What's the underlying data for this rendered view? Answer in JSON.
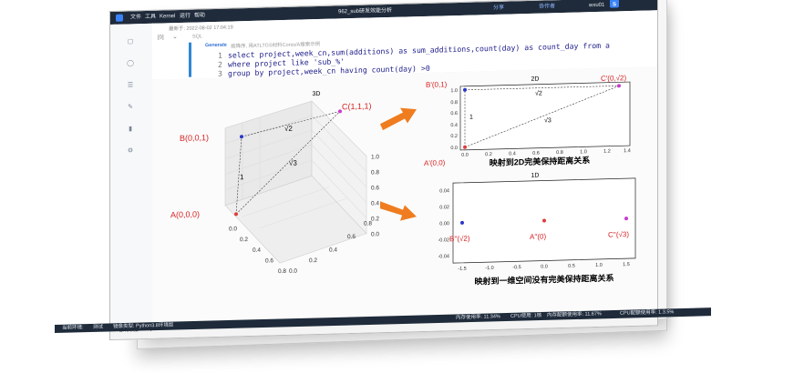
{
  "topbar": {
    "menu": [
      "文件",
      "工具",
      "Kernel",
      "运行",
      "帮助"
    ],
    "doc_title": "962_sub研发效能分析",
    "share": "分享",
    "collab": "协作者",
    "user": "wxu01",
    "avatar": "S"
  },
  "cell": {
    "saved": "最新于: 2022-08-02 17:04:19",
    "prompt_num": "[0]",
    "lang": "SQL",
    "gen_label": "Generate",
    "gen_hint": "按降序, 用ATLTGS材料Corss/A搜索示例",
    "code": [
      {
        "n": "1",
        "text": "select project,week_cn,sum(additions) as sum_additions,count(day) as count_day from a"
      },
      {
        "n": "2",
        "text": "where project like 'sub_%'"
      },
      {
        "n": "3",
        "text": "group by project,week_cn having count(day)  >0"
      }
    ]
  },
  "chart_data": [
    {
      "type": "scatter",
      "title": "3D",
      "points": [
        {
          "label": "A(0,0,0)",
          "x": 0,
          "y": 0,
          "z": 0,
          "color": "#e03a3a"
        },
        {
          "label": "B(0,0,1)",
          "x": 0,
          "y": 0,
          "z": 1,
          "color": "#2a35c8"
        },
        {
          "label": "C(1,1,1)",
          "x": 1,
          "y": 1,
          "z": 1,
          "color": "#c93ad0"
        }
      ],
      "edge_labels": [
        "1",
        "√2",
        "√3"
      ],
      "ticks": [
        "0.0",
        "0.2",
        "0.4",
        "0.6",
        "0.8",
        "1.0"
      ]
    },
    {
      "type": "scatter",
      "title": "2D",
      "caption": "映射到2D完美保持距离关系",
      "points": [
        {
          "label": "A'(0,0)",
          "x": 0,
          "y": 0,
          "color": "#e03a3a"
        },
        {
          "label": "B'(0,1)",
          "x": 0,
          "y": 1,
          "color": "#2a35c8"
        },
        {
          "label": "C'(0,√2)",
          "x": 1.3,
          "y": 1,
          "color": "#c93ad0"
        }
      ],
      "edge_labels": [
        "1",
        "√2",
        "√3"
      ],
      "xticks": [
        "0.0",
        "0.2",
        "0.4",
        "0.6",
        "0.8",
        "1.0",
        "1.2",
        "1.4"
      ],
      "yticks": [
        "0.0",
        "0.2",
        "0.4",
        "0.6",
        "0.8",
        "1.0"
      ]
    },
    {
      "type": "scatter",
      "title": "1D",
      "caption": "映射到一维空间没有完美保持距离关系",
      "points": [
        {
          "label": "B''(√2)",
          "x": -1.45,
          "y": 0,
          "color": "#2a35c8"
        },
        {
          "label": "A''(0)",
          "x": -0.1,
          "y": 0,
          "color": "#e03a3a"
        },
        {
          "label": "C''(√3)",
          "x": 1.5,
          "y": 0,
          "color": "#c93ad0"
        }
      ],
      "xticks": [
        "-1.5",
        "-1.0",
        "-0.5",
        "0.0",
        "0.5",
        "1.0",
        "1.5"
      ],
      "yticks": [
        "0.04",
        "0.02",
        "0.00",
        "-0.02",
        "-0.04"
      ]
    }
  ],
  "footer": {
    "sheet": "sheet1",
    "add": "+"
  },
  "statusbar": {
    "left": [
      "当前环境:",
      "测试",
      "镜像类型: Python3.8环境版"
    ],
    "right": [
      "内存使用率: 11.34%",
      "CPU使用: 1核",
      "内存配额使用率: 11.67%",
      "CPU配额使用率: 1.3.5%"
    ]
  }
}
